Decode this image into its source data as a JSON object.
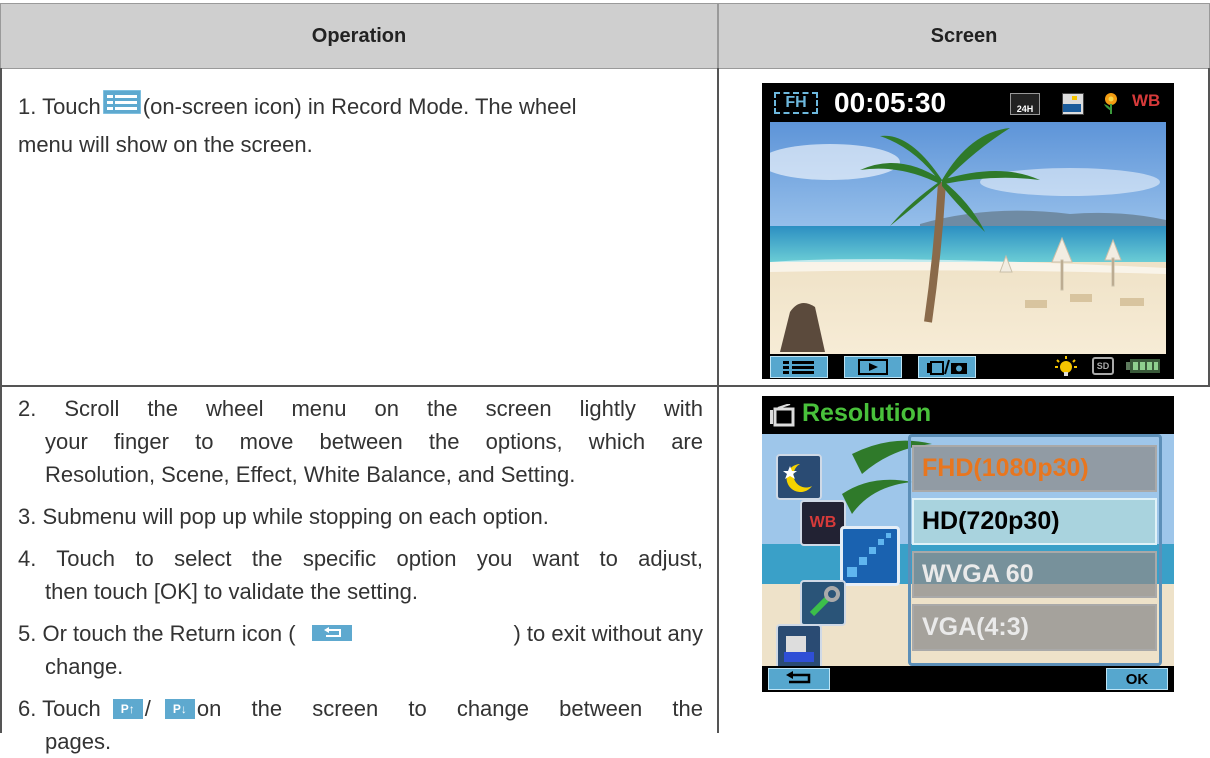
{
  "table": {
    "headers": {
      "operation": "Operation",
      "screen": "Screen"
    }
  },
  "steps": {
    "s1a": "1. Touch",
    "s1b": "(on-screen icon) in Record Mode. The wheel",
    "s1c": "menu will show on the screen.",
    "s2a": "2. Scroll the wheel menu on the screen lightly with",
    "s2b": "your finger to move between the options, which are",
    "s2c": "Resolution, Scene, Effect, White Balance, and Setting.",
    "s3": "3. Submenu will pop up while stopping on each option.",
    "s4a": "4. Touch to select the specific option you want to adjust,",
    "s4b": "then touch [OK] to validate the setting.",
    "s5a": "5. Or touch the Return icon (",
    "s5b": ") to exit without any",
    "s5c": "change.",
    "s6a": "6. Touch",
    "s6b": "on the screen to change between the",
    "s6c": "pages."
  },
  "screen1": {
    "format_badge": "FH",
    "timer": "00:05:30",
    "icon_fps": "24H",
    "icon_wb": "WB",
    "icon_sd": "SD",
    "icons": [
      "menu-icon",
      "playback-icon",
      "video-photo-mode-icon",
      "led-light-icon",
      "sd-card-icon",
      "battery-icon"
    ]
  },
  "screen2": {
    "title": "Resolution",
    "options": [
      "FHD(1080p30)",
      "HD(720p30)",
      "WVGA 60",
      "VGA(4:3)"
    ],
    "selected_index": 1,
    "ok_label": "OK",
    "wheel_icons": [
      "scene-night-icon",
      "white-balance-icon",
      "resolution-icon",
      "setting-icon",
      "effect-icon"
    ],
    "wb_label": "WB",
    "page_up_label": "P↑",
    "page_down_label": "P↓"
  },
  "colors": {
    "header_bg": "#cfcfcf",
    "highlight": "#e8761f",
    "selected_bg": "#a9d3de",
    "button_blue": "#56a7ce"
  }
}
